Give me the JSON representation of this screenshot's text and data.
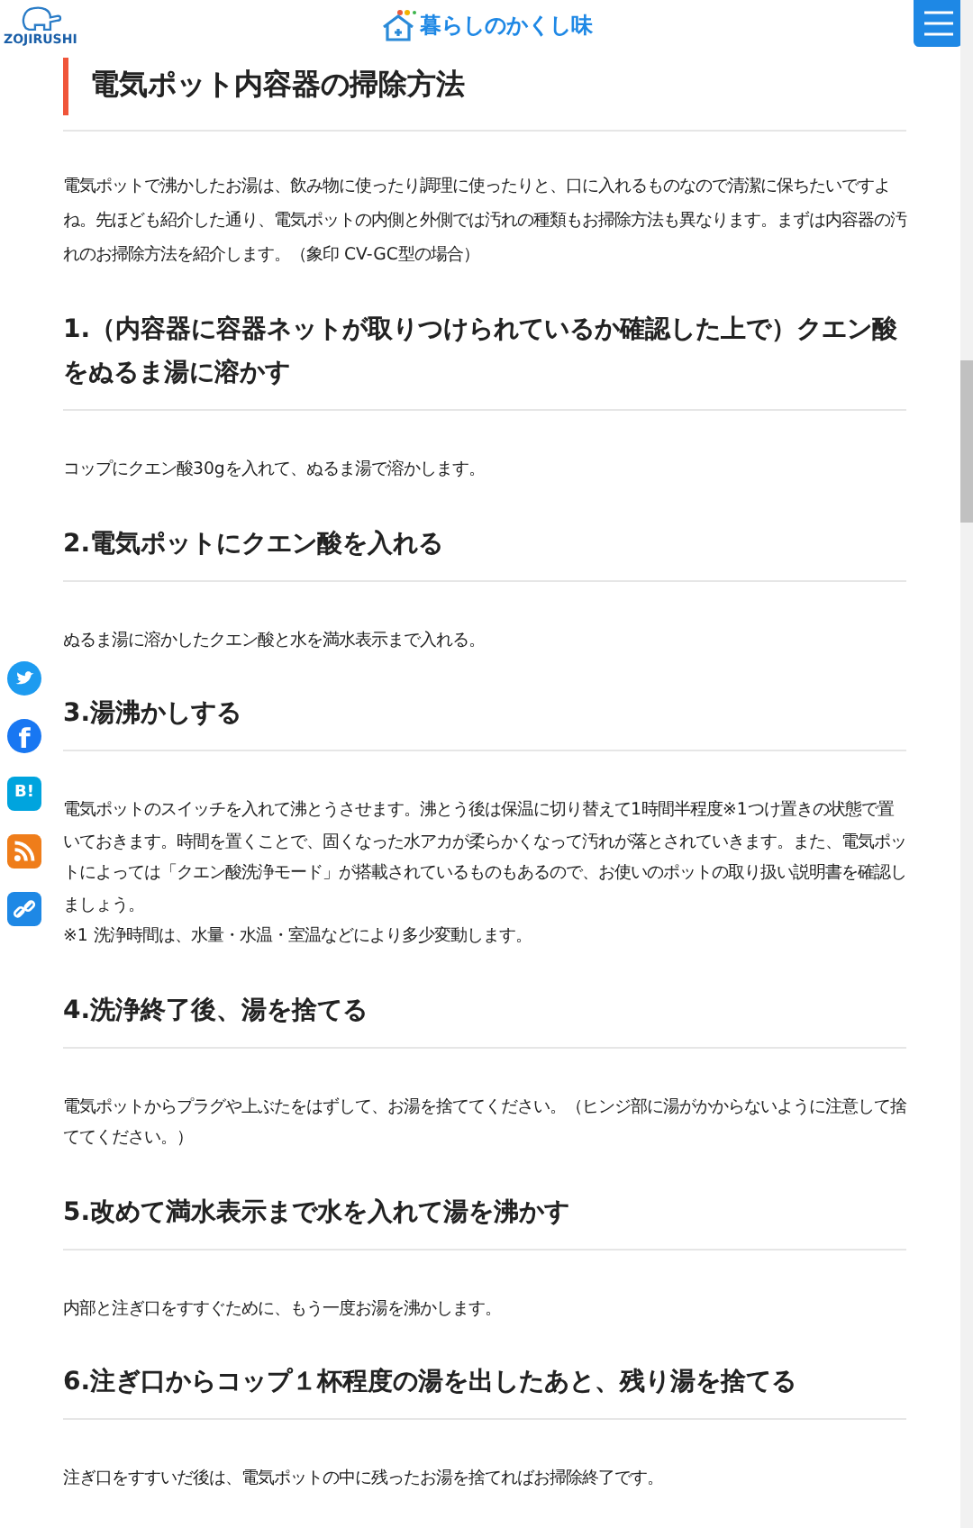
{
  "header": {
    "brand": "ZOJIRUSHI",
    "site_name": "暮らしのかくし味"
  },
  "title": "電気ポット内容器の掃除方法",
  "intro": [
    "電気ポットで沸かしたお湯は、飲み物に使ったり調理に使ったりと、口に入れるものなので清潔に保ちたいですよね。先ほども紹介した通り、電気ポットの内側と外側では汚れの種類もお掃除方法も異なります。まずは内容器の汚れのお掃除方法を紹介します。（象印 CV-GC型の場合）"
  ],
  "sections": [
    {
      "heading": "1.（内容器に容器ネットが取りつけられているか確認した上で）クエン酸をぬるま湯に溶かす",
      "body": [
        "コップにクエン酸30gを入れて、ぬるま湯で溶かします。"
      ]
    },
    {
      "heading": "2.電気ポットにクエン酸を入れる",
      "body": [
        "ぬるま湯に溶かしたクエン酸と水を満水表示まで入れる。"
      ]
    },
    {
      "heading": "3.湯沸かしする",
      "body": [
        "電気ポットのスイッチを入れて沸とうさせます。沸とう後は保温に切り替えて1時間半程度※1つけ置きの状態で置いておきます。時間を置くことで、固くなった水アカが柔らかくなって汚れが落とされていきます。また、電気ポットによっては「クエン酸洗浄モード」が搭載されているものもあるので、お使いのポットの取り扱い説明書を確認しましょう。",
        "※1 洗浄時間は、水量・水温・室温などにより多少変動します。"
      ]
    },
    {
      "heading": "4.洗浄終了後、湯を捨てる",
      "body": [
        "電気ポットからプラグや上ぶたをはずして、お湯を捨ててください。（ヒンジ部に湯がかからないように注意して捨ててください。）"
      ]
    },
    {
      "heading": "5.改めて満水表示まで水を入れて湯を沸かす",
      "body": [
        "内部と注ぎ口をすすぐために、もう一度お湯を沸かします。"
      ]
    },
    {
      "heading": "6.注ぎ口からコップ１杯程度の湯を出したあと、残り湯を捨てる",
      "body": [
        "注ぎ口をすすいだ後は、電気ポットの中に残ったお湯を捨てればお掃除終了です。"
      ]
    }
  ],
  "share": [
    {
      "kind": "twitter"
    },
    {
      "kind": "facebook",
      "label": "f"
    },
    {
      "kind": "hatena",
      "label": "B!"
    },
    {
      "kind": "rss"
    },
    {
      "kind": "link"
    }
  ]
}
